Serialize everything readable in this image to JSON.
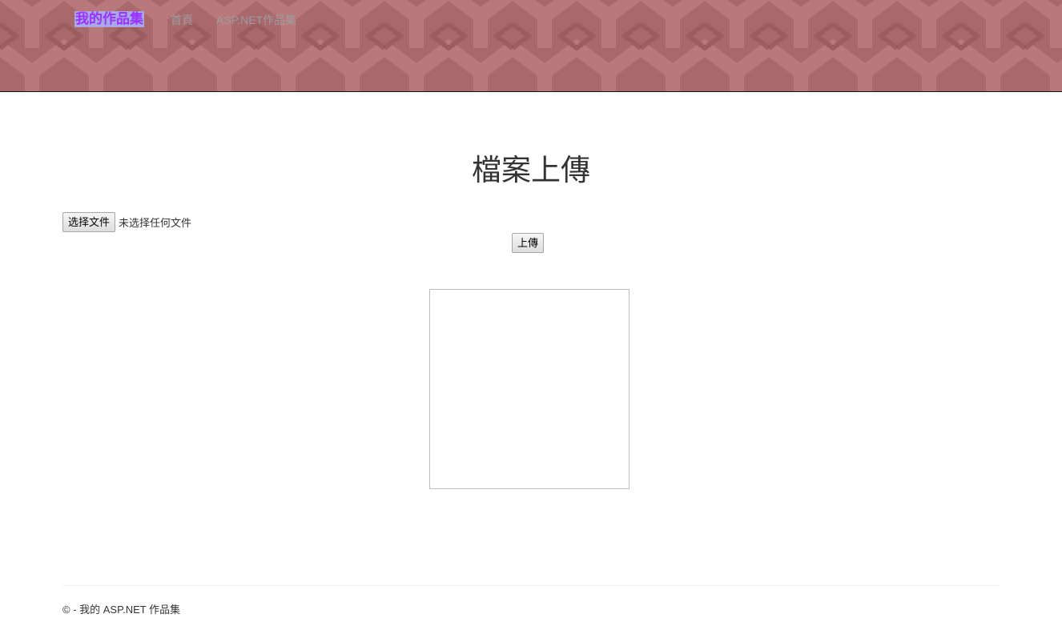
{
  "navbar": {
    "brand": "我的作品集",
    "links": [
      "首頁",
      "ASP.NET作品集"
    ]
  },
  "main": {
    "title": "檔案上傳",
    "file_input": {
      "button_label": "选择文件",
      "status_text": "未选择任何文件"
    },
    "upload_button": "上傳"
  },
  "footer": {
    "text": "© - 我的 ASP.NET 作品集"
  },
  "colors": {
    "header_background": "#a8686c",
    "brand_text": "#9b30ff",
    "brand_highlight": "#a9a9e6",
    "nav_link": "#9d9d9d"
  }
}
